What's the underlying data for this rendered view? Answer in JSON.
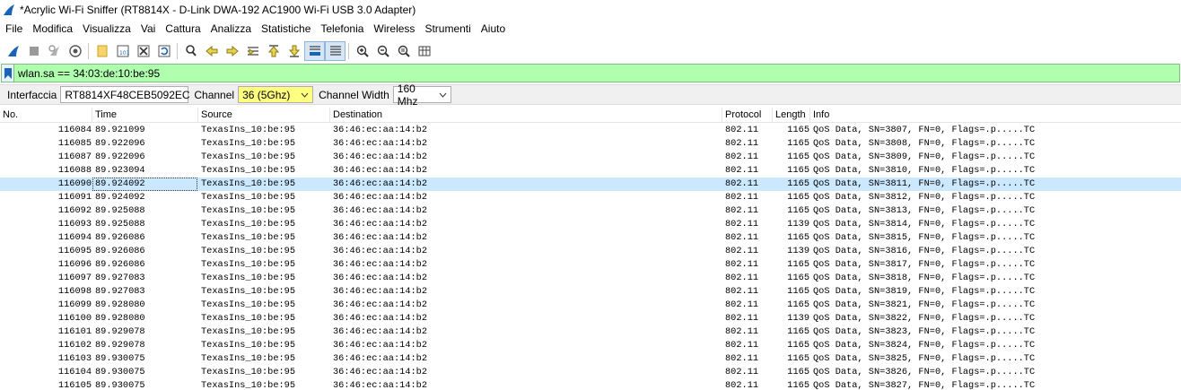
{
  "window": {
    "title": "*Acrylic Wi-Fi Sniffer (RT8814X - D-Link DWA-192 AC1900 Wi-Fi USB 3.0 Adapter)"
  },
  "menu": [
    "File",
    "Modifica",
    "Visualizza",
    "Vai",
    "Cattura",
    "Analizza",
    "Statistiche",
    "Telefonia",
    "Wireless",
    "Strumenti",
    "Aiuto"
  ],
  "toolbar": {
    "icons": [
      "shark-fin-start-icon",
      "stop-icon",
      "restart-icon",
      "capture-options-icon",
      "open-file-icon",
      "save-file-icon",
      "close-file-icon",
      "reload-icon",
      "find-packet-icon",
      "go-back-icon",
      "go-forward-icon",
      "go-to-packet-icon",
      "go-first-icon",
      "go-last-icon",
      "autoscroll-icon",
      "colorize-icon",
      "zoom-in-icon",
      "zoom-out-icon",
      "zoom-reset-icon",
      "resize-columns-icon"
    ]
  },
  "filter": {
    "value": "wlan.sa == 34:03:de:10:be:95",
    "background": "#afffaf"
  },
  "capture": {
    "interface_label": "Interfaccia",
    "interface_value": "RT8814XF48CEB5092EC",
    "channel_label": "Channel",
    "channel_value": "36 (5Ghz)",
    "width_label": "Channel Width",
    "width_value": "160 Mhz"
  },
  "columns": [
    "No.",
    "Time",
    "Source",
    "Destination",
    "Protocol",
    "Length",
    "Info"
  ],
  "selected_color": "#cce8ff",
  "packets": [
    {
      "no": "116084",
      "time": "89.921099",
      "src": "TexasIns_10:be:95",
      "dst": "36:46:ec:aa:14:b2",
      "proto": "802.11",
      "len": "1165",
      "info": "QoS Data, SN=3807, FN=0, Flags=.p.....TC"
    },
    {
      "no": "116085",
      "time": "89.922096",
      "src": "TexasIns_10:be:95",
      "dst": "36:46:ec:aa:14:b2",
      "proto": "802.11",
      "len": "1165",
      "info": "QoS Data, SN=3808, FN=0, Flags=.p.....TC"
    },
    {
      "no": "116087",
      "time": "89.922096",
      "src": "TexasIns_10:be:95",
      "dst": "36:46:ec:aa:14:b2",
      "proto": "802.11",
      "len": "1165",
      "info": "QoS Data, SN=3809, FN=0, Flags=.p.....TC"
    },
    {
      "no": "116088",
      "time": "89.923094",
      "src": "TexasIns_10:be:95",
      "dst": "36:46:ec:aa:14:b2",
      "proto": "802.11",
      "len": "1165",
      "info": "QoS Data, SN=3810, FN=0, Flags=.p.....TC"
    },
    {
      "no": "116090",
      "time": "89.924092",
      "src": "TexasIns_10:be:95",
      "dst": "36:46:ec:aa:14:b2",
      "proto": "802.11",
      "len": "1165",
      "info": "QoS Data, SN=3811, FN=0, Flags=.p.....TC",
      "selected": true
    },
    {
      "no": "116091",
      "time": "89.924092",
      "src": "TexasIns_10:be:95",
      "dst": "36:46:ec:aa:14:b2",
      "proto": "802.11",
      "len": "1165",
      "info": "QoS Data, SN=3812, FN=0, Flags=.p.....TC"
    },
    {
      "no": "116092",
      "time": "89.925088",
      "src": "TexasIns_10:be:95",
      "dst": "36:46:ec:aa:14:b2",
      "proto": "802.11",
      "len": "1165",
      "info": "QoS Data, SN=3813, FN=0, Flags=.p.....TC"
    },
    {
      "no": "116093",
      "time": "89.925088",
      "src": "TexasIns_10:be:95",
      "dst": "36:46:ec:aa:14:b2",
      "proto": "802.11",
      "len": "1139",
      "info": "QoS Data, SN=3814, FN=0, Flags=.p.....TC"
    },
    {
      "no": "116094",
      "time": "89.926086",
      "src": "TexasIns_10:be:95",
      "dst": "36:46:ec:aa:14:b2",
      "proto": "802.11",
      "len": "1165",
      "info": "QoS Data, SN=3815, FN=0, Flags=.p.....TC"
    },
    {
      "no": "116095",
      "time": "89.926086",
      "src": "TexasIns_10:be:95",
      "dst": "36:46:ec:aa:14:b2",
      "proto": "802.11",
      "len": "1139",
      "info": "QoS Data, SN=3816, FN=0, Flags=.p.....TC"
    },
    {
      "no": "116096",
      "time": "89.926086",
      "src": "TexasIns_10:be:95",
      "dst": "36:46:ec:aa:14:b2",
      "proto": "802.11",
      "len": "1165",
      "info": "QoS Data, SN=3817, FN=0, Flags=.p.....TC"
    },
    {
      "no": "116097",
      "time": "89.927083",
      "src": "TexasIns_10:be:95",
      "dst": "36:46:ec:aa:14:b2",
      "proto": "802.11",
      "len": "1165",
      "info": "QoS Data, SN=3818, FN=0, Flags=.p.....TC"
    },
    {
      "no": "116098",
      "time": "89.927083",
      "src": "TexasIns_10:be:95",
      "dst": "36:46:ec:aa:14:b2",
      "proto": "802.11",
      "len": "1165",
      "info": "QoS Data, SN=3819, FN=0, Flags=.p.....TC"
    },
    {
      "no": "116099",
      "time": "89.928080",
      "src": "TexasIns_10:be:95",
      "dst": "36:46:ec:aa:14:b2",
      "proto": "802.11",
      "len": "1165",
      "info": "QoS Data, SN=3821, FN=0, Flags=.p.....TC"
    },
    {
      "no": "116100",
      "time": "89.928080",
      "src": "TexasIns_10:be:95",
      "dst": "36:46:ec:aa:14:b2",
      "proto": "802.11",
      "len": "1139",
      "info": "QoS Data, SN=3822, FN=0, Flags=.p.....TC"
    },
    {
      "no": "116101",
      "time": "89.929078",
      "src": "TexasIns_10:be:95",
      "dst": "36:46:ec:aa:14:b2",
      "proto": "802.11",
      "len": "1165",
      "info": "QoS Data, SN=3823, FN=0, Flags=.p.....TC"
    },
    {
      "no": "116102",
      "time": "89.929078",
      "src": "TexasIns_10:be:95",
      "dst": "36:46:ec:aa:14:b2",
      "proto": "802.11",
      "len": "1165",
      "info": "QoS Data, SN=3824, FN=0, Flags=.p.....TC"
    },
    {
      "no": "116103",
      "time": "89.930075",
      "src": "TexasIns_10:be:95",
      "dst": "36:46:ec:aa:14:b2",
      "proto": "802.11",
      "len": "1165",
      "info": "QoS Data, SN=3825, FN=0, Flags=.p.....TC"
    },
    {
      "no": "116104",
      "time": "89.930075",
      "src": "TexasIns_10:be:95",
      "dst": "36:46:ec:aa:14:b2",
      "proto": "802.11",
      "len": "1165",
      "info": "QoS Data, SN=3826, FN=0, Flags=.p.....TC"
    },
    {
      "no": "116105",
      "time": "89.930075",
      "src": "TexasIns_10:be:95",
      "dst": "36:46:ec:aa:14:b2",
      "proto": "802.11",
      "len": "1165",
      "info": "QoS Data, SN=3827, FN=0, Flags=.p.....TC"
    }
  ]
}
